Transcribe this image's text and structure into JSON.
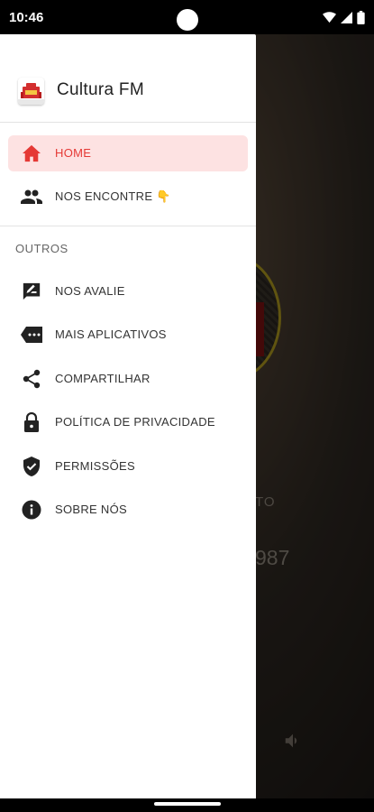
{
  "status_bar": {
    "time": "10:46"
  },
  "drawer": {
    "app_title": "Cultura FM",
    "menu": [
      {
        "label": "HOME",
        "icon": "home-icon",
        "active": true
      },
      {
        "label": "NOS ENCONTRE 👇",
        "icon": "people-icon",
        "active": false
      }
    ],
    "section_label": "OUTROS",
    "others": [
      {
        "label": "NOS AVALIE",
        "icon": "rate-review-icon"
      },
      {
        "label": "MAIS APLICATIVOS",
        "icon": "more-apps-icon"
      },
      {
        "label": "COMPARTILHAR",
        "icon": "share-icon"
      },
      {
        "label": "POLÍTICA DE PRIVACIDADE",
        "icon": "lock-icon"
      },
      {
        "label": "PERMISSÕES",
        "icon": "shield-check-icon"
      },
      {
        "label": "SOBRE NÓS",
        "icon": "info-icon"
      }
    ]
  },
  "background": {
    "small_text": "TO",
    "large_text": "987"
  },
  "colors": {
    "accent": "#e53935",
    "active_bg": "#fde2e2",
    "icon": "#222222"
  }
}
